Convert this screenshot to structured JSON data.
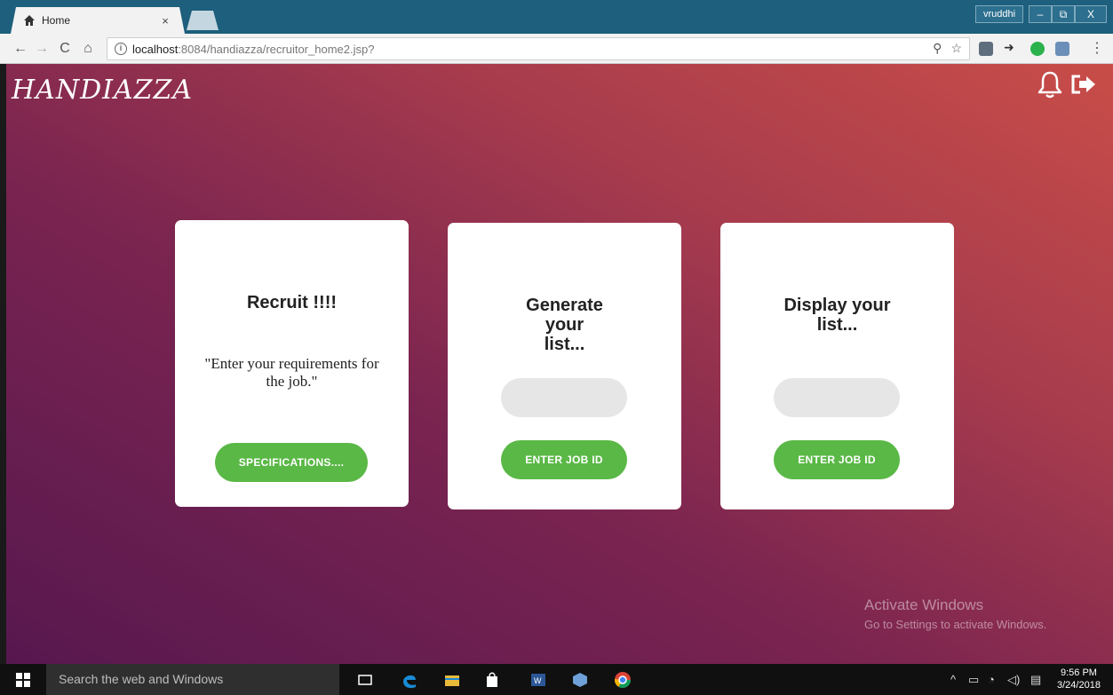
{
  "browser": {
    "tab_title": "Home",
    "tab_close": "×",
    "user": "vruddhi",
    "min_label": "–",
    "restore_label": "⧉",
    "close_label": "X",
    "url_host": "localhost",
    "url_rest": ":8084/handiazza/recruitor_home2.jsp?"
  },
  "page": {
    "logo": "HANDIAZZA",
    "cards": [
      {
        "title": "Recruit !!!!",
        "quote": "\"Enter your requirements for the job.\"",
        "button": "SPECIFICATIONS...."
      },
      {
        "title": "Generate your list...",
        "input_value": "",
        "button": "ENTER JOB ID"
      },
      {
        "title": "Display your list...",
        "input_value": "",
        "button": "ENTER JOB ID"
      }
    ],
    "watermark_title": "Activate Windows",
    "watermark_sub": "Go to Settings to activate Windows."
  },
  "taskbar": {
    "search_placeholder": "Search the web and Windows",
    "time": "9:56 PM",
    "date": "3/24/2018"
  },
  "colors": {
    "accent_green": "#5ab846",
    "titlebar": "#1d5f7d"
  }
}
